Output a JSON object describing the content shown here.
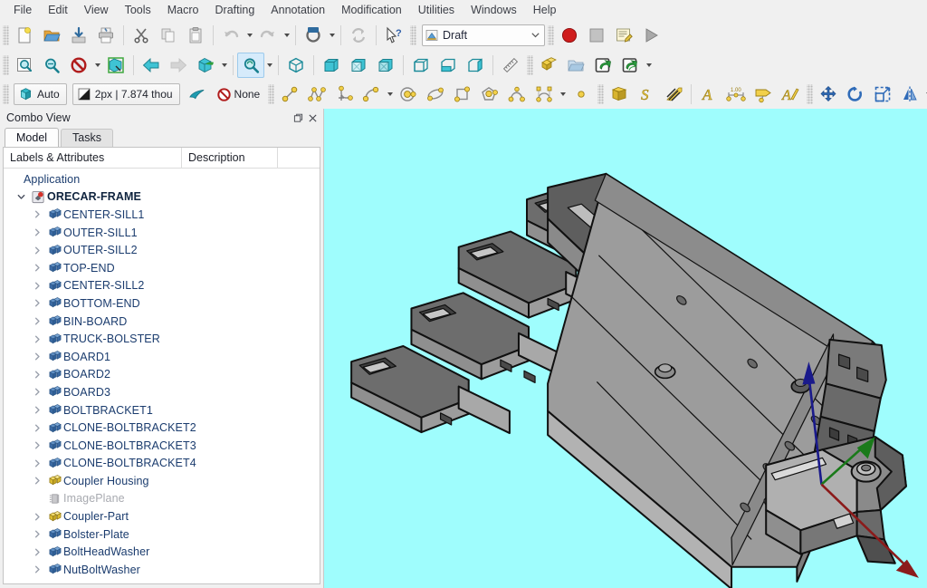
{
  "menubar": {
    "items": [
      {
        "label": "File",
        "name": "menu-file"
      },
      {
        "label": "Edit",
        "name": "menu-edit"
      },
      {
        "label": "View",
        "name": "menu-view"
      },
      {
        "label": "Tools",
        "name": "menu-tools"
      },
      {
        "label": "Macro",
        "name": "menu-macro"
      },
      {
        "label": "Drafting",
        "name": "menu-drafting"
      },
      {
        "label": "Annotation",
        "name": "menu-annotation"
      },
      {
        "label": "Modification",
        "name": "menu-modification"
      },
      {
        "label": "Utilities",
        "name": "menu-utilities"
      },
      {
        "label": "Windows",
        "name": "menu-windows"
      },
      {
        "label": "Help",
        "name": "menu-help"
      }
    ]
  },
  "toolbars": {
    "file": {
      "icons": [
        "new-document-icon",
        "open-folder-icon",
        "save-icon",
        "print-icon",
        "cut-scissors-icon",
        "copy-icon",
        "paste-clipboard-icon",
        "undo-arrow-icon",
        "redo-arrow-icon",
        "refresh-icon",
        "whats-this-icon"
      ]
    },
    "workbench": {
      "selected": "Draft",
      "icon": "draft-workbench-icon",
      "chevron": "chevron-down-icon"
    },
    "macro": {
      "icons": [
        "macro-record-icon",
        "macro-stop-icon",
        "macro-edit-icon",
        "macro-execute-icon"
      ]
    },
    "view": {
      "icons": [
        "fit-all-icon",
        "fit-selection-icon",
        "draw-style-icon",
        "box-selection-icon",
        "std-view-back-icon",
        "std-view-forward-icon",
        "isometric-view-icon",
        "zoom-tool-icon"
      ]
    },
    "std_views": {
      "icons": [
        "axonometric-cube-icon",
        "front-view-cube-icon",
        "top-view-cube-icon",
        "right-view-cube-icon",
        "rear-view-cube-icon",
        "bottom-view-cube-icon",
        "left-view-cube-icon",
        "measure-ruler-icon"
      ]
    },
    "structure": {
      "icons": [
        "create-part-icon",
        "create-group-icon",
        "make-link-icon",
        "link-group-icon"
      ]
    },
    "draft_tray": {
      "autogroup_label": "Auto",
      "autogroup_icon": "autogroup-icon",
      "linewidth_label": "2px | 7.874 thou",
      "linewidth_icon": "linewidth-color-icon",
      "annotation_icon": "annotation-style-icon",
      "working_plane_label": "None",
      "working_plane_icon": "no-plane-icon"
    },
    "draft_creation": {
      "icons": [
        "draft-line-icon",
        "draft-polyline-icon",
        "draft-fillet-icon",
        "draft-arc-icon",
        "draft-circle-icon",
        "draft-ellipse-icon",
        "draft-rectangle-icon",
        "draft-polygon-icon",
        "draft-bspline-icon",
        "draft-bezier-icon",
        "draft-point-icon"
      ]
    },
    "draft_annotation": {
      "icons": [
        "draft-facebinder-icon",
        "draft-shapestring-icon",
        "draft-hatch-icon",
        "draft-text-icon",
        "draft-dimension-icon",
        "draft-label-icon",
        "draft-annotation-styles-icon"
      ]
    },
    "draft_modify": {
      "icons": [
        "draft-move-icon",
        "draft-rotate-icon",
        "draft-scale-icon",
        "draft-mirror-icon"
      ]
    }
  },
  "combo_view": {
    "title": "Combo View",
    "float_icon": "float-window-icon",
    "close_icon": "close-icon",
    "tabs": [
      {
        "label": "Model",
        "name": "tab-model",
        "selected": true
      },
      {
        "label": "Tasks",
        "name": "tab-tasks",
        "selected": false
      }
    ],
    "tree_headers": [
      "Labels & Attributes",
      "Description",
      ""
    ],
    "tree": [
      {
        "label": "Application",
        "level": 0,
        "icon": "none",
        "twisty": false,
        "style": "app"
      },
      {
        "label": "ORECAR-FRAME",
        "level": 1,
        "icon": "document-icon",
        "twisty": "expanded",
        "style": "doc"
      },
      {
        "label": "CENTER-SILL1",
        "level": 2,
        "icon": "part-blue-icon",
        "twisty": "collapsed",
        "style": "item"
      },
      {
        "label": "OUTER-SILL1",
        "level": 2,
        "icon": "part-blue-icon",
        "twisty": "collapsed",
        "style": "item"
      },
      {
        "label": "OUTER-SILL2",
        "level": 2,
        "icon": "part-blue-icon",
        "twisty": "collapsed",
        "style": "item"
      },
      {
        "label": "TOP-END",
        "level": 2,
        "icon": "part-blue-icon",
        "twisty": "collapsed",
        "style": "item"
      },
      {
        "label": "CENTER-SILL2",
        "level": 2,
        "icon": "part-blue-icon",
        "twisty": "collapsed",
        "style": "item"
      },
      {
        "label": "BOTTOM-END",
        "level": 2,
        "icon": "part-blue-icon",
        "twisty": "collapsed",
        "style": "item"
      },
      {
        "label": "BIN-BOARD",
        "level": 2,
        "icon": "part-blue-icon",
        "twisty": "collapsed",
        "style": "item"
      },
      {
        "label": "TRUCK-BOLSTER",
        "level": 2,
        "icon": "part-blue-icon",
        "twisty": "collapsed",
        "style": "item"
      },
      {
        "label": "BOARD1",
        "level": 2,
        "icon": "part-blue-icon",
        "twisty": "collapsed",
        "style": "item"
      },
      {
        "label": "BOARD2",
        "level": 2,
        "icon": "part-blue-icon",
        "twisty": "collapsed",
        "style": "item"
      },
      {
        "label": "BOARD3",
        "level": 2,
        "icon": "part-blue-icon",
        "twisty": "collapsed",
        "style": "item"
      },
      {
        "label": "BOLTBRACKET1",
        "level": 2,
        "icon": "part-blue-icon",
        "twisty": "collapsed",
        "style": "item"
      },
      {
        "label": "CLONE-BOLTBRACKET2",
        "level": 2,
        "icon": "part-blue-icon",
        "twisty": "collapsed",
        "style": "item"
      },
      {
        "label": "CLONE-BOLTBRACKET3",
        "level": 2,
        "icon": "part-blue-icon",
        "twisty": "collapsed",
        "style": "item"
      },
      {
        "label": "CLONE-BOLTBRACKET4",
        "level": 2,
        "icon": "part-blue-icon",
        "twisty": "collapsed",
        "style": "item"
      },
      {
        "label": "Coupler Housing",
        "level": 2,
        "icon": "part-yellow-icon",
        "twisty": "collapsed",
        "style": "item"
      },
      {
        "label": "ImagePlane",
        "level": 2,
        "icon": "image-plane-icon",
        "twisty": false,
        "style": "dim"
      },
      {
        "label": "Coupler-Part",
        "level": 2,
        "icon": "part-yellow-icon",
        "twisty": "collapsed",
        "style": "item"
      },
      {
        "label": "Bolster-Plate",
        "level": 2,
        "icon": "part-blue-icon",
        "twisty": "collapsed",
        "style": "item"
      },
      {
        "label": "BoltHeadWasher",
        "level": 2,
        "icon": "part-blue-icon",
        "twisty": "collapsed",
        "style": "item"
      },
      {
        "label": "NutBoltWasher",
        "level": 2,
        "icon": "part-blue-icon",
        "twisty": "collapsed",
        "style": "item"
      }
    ]
  },
  "viewport": {
    "name": "3d-view",
    "background_color": "#9ffdfd",
    "model_name": "ORECAR-FRAME",
    "axis_cross": {
      "x_axis_color": "#8b1a1a",
      "y_axis_color": "#1a7a1a",
      "z_axis_color": "#1a1a8b"
    },
    "shading": {
      "face_light": "#b9b9b9",
      "face_mid": "#9b9b9b",
      "face_dark": "#6e6e6e",
      "face_darker": "#565656",
      "edge_color": "#101010"
    }
  }
}
